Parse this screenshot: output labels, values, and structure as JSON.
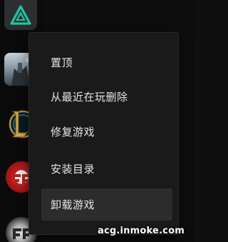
{
  "sidebar": {
    "apps": [
      {
        "icon": "triangle-logo-icon",
        "state": "active"
      },
      {
        "icon": "game-castle-icon"
      },
      {
        "icon": "league-of-legends-icon"
      },
      {
        "icon": "crossfire-icon"
      },
      {
        "icon": "crossfire-hd-icon"
      }
    ]
  },
  "context_menu": {
    "items": [
      {
        "label": "置顶"
      },
      {
        "label": "从最近在玩删除"
      },
      {
        "label": "修复游戏"
      },
      {
        "label": "安装目录"
      },
      {
        "label": "卸载游戏",
        "highlighted": true
      }
    ]
  },
  "watermark": {
    "text": "acg.inmoke.com"
  },
  "colors": {
    "accent_green": "#22c4a0",
    "menu_background": "#1a1a1b",
    "menu_hover": "#2c2c2d",
    "text": "#e6e6e6"
  }
}
